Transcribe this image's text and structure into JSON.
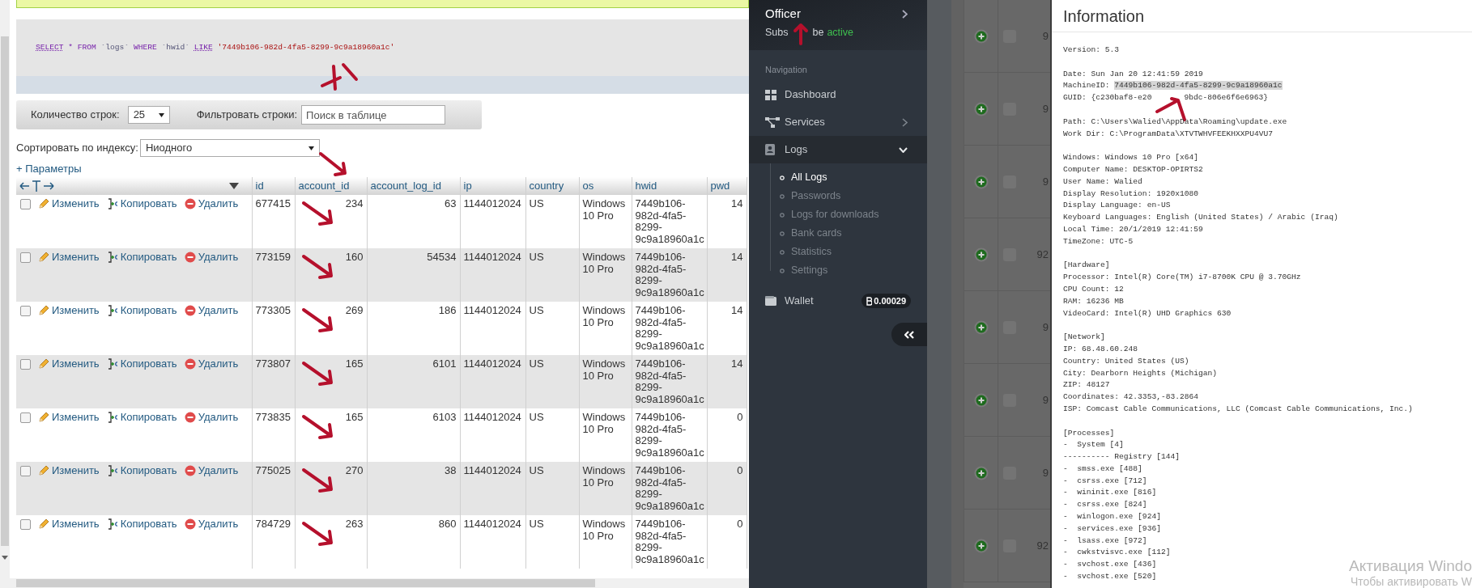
{
  "sql_panel": {
    "annotated": true,
    "tokens": [
      {
        "kind": "keyword_link",
        "text": "SELECT"
      },
      {
        "kind": "keyword",
        "text": "* FROM"
      },
      {
        "kind": "identifier",
        "text": "`logs`"
      },
      {
        "kind": "keyword",
        "text": "WHERE"
      },
      {
        "kind": "identifier",
        "text": "`hwid`"
      },
      {
        "kind": "keyword_link",
        "text": "LIKE"
      },
      {
        "kind": "string",
        "text": "'7449b106-982d-4fa5-8299-9c9a18960a1c'"
      }
    ]
  },
  "toolbar": {
    "rows_label": "Количество строк:",
    "rows_value": "25",
    "filter_label": "Фильтровать строки:",
    "filter_placeholder": "Поиск в таблице"
  },
  "sort": {
    "label": "Сортировать по индексу:",
    "value": "Ниодного"
  },
  "options_link": "+ Параметры",
  "table": {
    "columns": [
      "id",
      "account_id",
      "account_log_id",
      "ip",
      "country",
      "os",
      "hwid",
      "pwd"
    ],
    "rows": [
      {
        "checked": false,
        "annotated": true,
        "actions": [
          "Изменить",
          "Копировать",
          "Удалить"
        ],
        "cells": [
          "677415",
          "234",
          "63",
          "1144012024",
          "US",
          "Windows 10 Pro",
          "7449b106-982d-4fa5-8299-9c9a18960a1c",
          "14"
        ]
      },
      {
        "checked": false,
        "annotated": true,
        "actions": [
          "Изменить",
          "Копировать",
          "Удалить"
        ],
        "cells": [
          "773159",
          "160",
          "54534",
          "1144012024",
          "US",
          "Windows 10 Pro",
          "7449b106-982d-4fa5-8299-9c9a18960a1c",
          "14"
        ]
      },
      {
        "checked": false,
        "annotated": true,
        "actions": [
          "Изменить",
          "Копировать",
          "Удалить"
        ],
        "cells": [
          "773305",
          "269",
          "186",
          "1144012024",
          "US",
          "Windows 10 Pro",
          "7449b106-982d-4fa5-8299-9c9a18960a1c",
          "14"
        ]
      },
      {
        "checked": false,
        "annotated": true,
        "actions": [
          "Изменить",
          "Копировать",
          "Удалить"
        ],
        "cells": [
          "773807",
          "165",
          "6101",
          "1144012024",
          "US",
          "Windows 10 Pro",
          "7449b106-982d-4fa5-8299-9c9a18960a1c",
          "14"
        ]
      },
      {
        "checked": false,
        "annotated": true,
        "actions": [
          "Изменить",
          "Копировать",
          "Удалить"
        ],
        "cells": [
          "773835",
          "165",
          "6103",
          "1144012024",
          "US",
          "Windows 10 Pro",
          "7449b106-982d-4fa5-8299-9c9a18960a1c",
          "0"
        ]
      },
      {
        "checked": false,
        "annotated": true,
        "actions": [
          "Изменить",
          "Копировать",
          "Удалить"
        ],
        "cells": [
          "775025",
          "270",
          "38",
          "1144012024",
          "US",
          "Windows 10 Pro",
          "7449b106-982d-4fa5-8299-9c9a18960a1c",
          "0"
        ]
      },
      {
        "checked": false,
        "annotated": true,
        "actions": [
          "Изменить",
          "Копировать",
          "Удалить"
        ],
        "cells": [
          "784729",
          "263",
          "860",
          "1144012024",
          "US",
          "Windows 10 Pro",
          "7449b106-982d-4fa5-8299-9c9a18960a1c",
          "0"
        ]
      }
    ]
  },
  "sidebar": {
    "user": "Officer",
    "subtitle_parts": [
      "Subs",
      "be"
    ],
    "status": "active",
    "section_label": "Navigation",
    "items": [
      {
        "kind": "link",
        "label": "Dashboard",
        "selected": false
      },
      {
        "kind": "group",
        "label": "Services",
        "expanded": false,
        "selected": false
      },
      {
        "kind": "group",
        "label": "Logs",
        "expanded": true,
        "selected": true,
        "children": [
          {
            "label": "All Logs",
            "selected": true
          },
          {
            "label": "Passwords",
            "selected": false
          },
          {
            "label": "Logs for downloads",
            "selected": false
          },
          {
            "label": "Bank cards",
            "selected": false
          },
          {
            "label": "Statistics",
            "selected": false
          },
          {
            "label": "Settings",
            "selected": false
          }
        ]
      },
      {
        "kind": "balance",
        "label": "Wallet",
        "badge": "0.00029",
        "selected": false
      }
    ]
  },
  "background_table": {
    "rows": [
      {
        "column_3": "9",
        "checked": false
      },
      {
        "column_3": "9",
        "checked": false
      },
      {
        "column_3": "9",
        "checked": false
      },
      {
        "column_3": "92",
        "checked": false
      },
      {
        "column_3": "9",
        "checked": false
      },
      {
        "column_3": "9",
        "checked": false
      },
      {
        "column_3": "9",
        "checked": false
      },
      {
        "column_3": "92",
        "checked": false
      }
    ]
  },
  "info_panel": {
    "title": "Information",
    "sections": [
      [
        {
          "kind": "plain",
          "text": "Version: 5.3"
        }
      ],
      [
        {
          "kind": "plain",
          "text": "Date: Sun Jan 20 12:41:59 2019"
        },
        {
          "kind": "highlight",
          "text": "MachineID: ",
          "highlight": "7449b106-982d-4fa5-8299-9c9a18960a1c"
        },
        {
          "kind": "obscured",
          "text": "GUID: {c230baf8-e20",
          "after": "9bdc-806e6f6e6963}"
        }
      ],
      [
        {
          "kind": "plain",
          "text": "Path: C:\\Users\\Walied\\AppData\\Roaming\\update.exe"
        },
        {
          "kind": "plain",
          "text": "Work Dir: C:\\ProgramData\\XTVTWHVFEEKHXXPU4VU7"
        }
      ],
      [
        {
          "kind": "plain",
          "text": "Windows: Windows 10 Pro [x64]"
        },
        {
          "kind": "plain",
          "text": "Computer Name: DESKTOP-OPIRTS2"
        },
        {
          "kind": "plain",
          "text": "User Name: Walied"
        },
        {
          "kind": "plain",
          "text": "Display Resolution: 1920x1080"
        },
        {
          "kind": "plain",
          "text": "Display Language: en-US"
        },
        {
          "kind": "plain",
          "text": "Keyboard Languages: English (United States) / Arabic (Iraq)"
        },
        {
          "kind": "plain",
          "text": "Local Time: 20/1/2019 12:41:59"
        },
        {
          "kind": "plain",
          "text": "TimeZone: UTC-5"
        }
      ],
      [
        {
          "kind": "plain",
          "text": "[Hardware]"
        },
        {
          "kind": "plain",
          "text": "Processor: Intel(R) Core(TM) i7-8700K CPU @ 3.70GHz"
        },
        {
          "kind": "plain",
          "text": "CPU Count: 12"
        },
        {
          "kind": "plain",
          "text": "RAM: 16236 MB"
        },
        {
          "kind": "plain",
          "text": "VideoCard: Intel(R) UHD Graphics 630"
        }
      ],
      [
        {
          "kind": "plain",
          "text": "[Network]"
        },
        {
          "kind": "plain",
          "text": "IP: 68.48.60.248"
        },
        {
          "kind": "plain",
          "text": "Country: United States (US)"
        },
        {
          "kind": "plain",
          "text": "City: Dearborn Heights (Michigan)"
        },
        {
          "kind": "plain",
          "text": "ZIP: 48127"
        },
        {
          "kind": "plain",
          "text": "Coordinates: 42.3353,-83.2864"
        },
        {
          "kind": "plain",
          "text": "ISP: Comcast Cable Communications, LLC (Comcast Cable Communications, Inc.)"
        }
      ],
      [
        {
          "kind": "plain",
          "text": "[Processes]"
        },
        {
          "kind": "plain",
          "text": "-  System [4]"
        },
        {
          "kind": "plain",
          "text": "---------- Registry [144]"
        },
        {
          "kind": "plain",
          "text": "-  smss.exe [488]"
        },
        {
          "kind": "plain",
          "text": "-  csrss.exe [712]"
        },
        {
          "kind": "plain",
          "text": "-  wininit.exe [816]"
        },
        {
          "kind": "plain",
          "text": "-  csrss.exe [824]"
        },
        {
          "kind": "plain",
          "text": "-  winlogon.exe [924]"
        },
        {
          "kind": "plain",
          "text": "-  services.exe [936]"
        },
        {
          "kind": "plain",
          "text": "-  lsass.exe [972]"
        },
        {
          "kind": "plain",
          "text": "-  cwkstvisvc.exe [112]"
        },
        {
          "kind": "plain",
          "text": "-  svchost.exe [436]"
        },
        {
          "kind": "plain",
          "text": "-  svchost.exe [520]"
        }
      ]
    ]
  },
  "activation_notice": [
    "Активация Windo",
    "Чтобы активировать W"
  ]
}
